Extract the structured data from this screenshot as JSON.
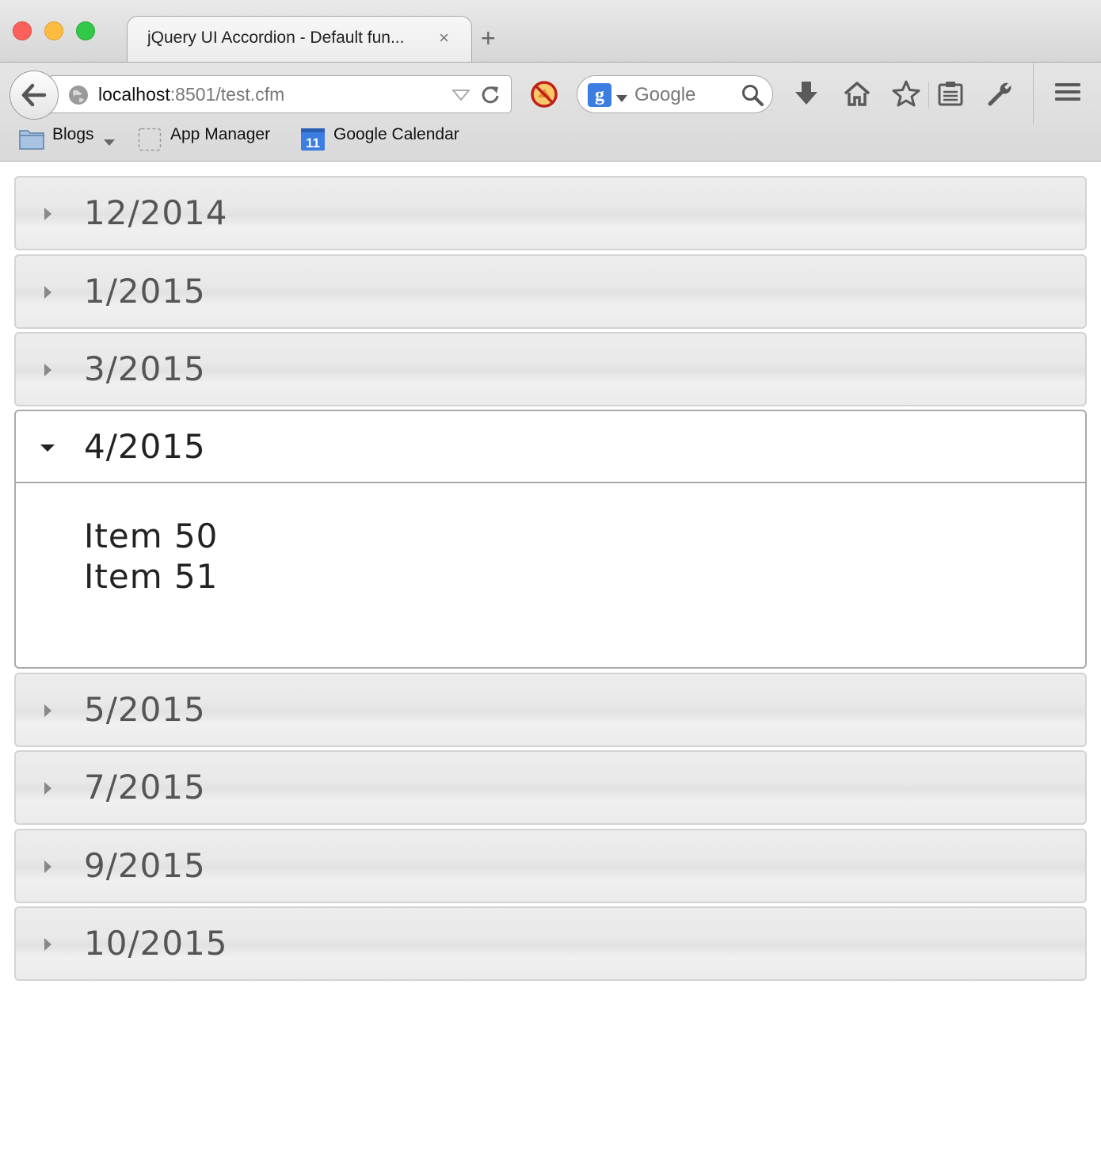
{
  "browser": {
    "tab_title": "jQuery UI Accordion - Default fun...",
    "tab_close": "×",
    "new_tab": "+",
    "url_host": "localhost",
    "url_rest": ":8501/test.cfm",
    "search_engine_badge": "g",
    "search_placeholder": "Google",
    "icons": [
      "back-arrow-icon",
      "globe-icon",
      "dropdown-triangle-icon",
      "reload-icon",
      "blocked-addon-icon",
      "search-icon",
      "download-icon",
      "home-icon",
      "bookmark-star-icon",
      "reading-list-icon",
      "wrench-icon",
      "hamburger-menu-icon"
    ]
  },
  "bookmarks": [
    {
      "label": "Blogs",
      "icon": "folder-icon"
    },
    {
      "label": "App Manager",
      "icon": "app-placeholder-icon"
    },
    {
      "label": "Google Calendar",
      "icon": "calendar-icon",
      "badge": "11"
    }
  ],
  "accordion": {
    "sections": [
      {
        "label": "12/2014",
        "active": false
      },
      {
        "label": "1/2015",
        "active": false
      },
      {
        "label": "3/2015",
        "active": false
      },
      {
        "label": "4/2015",
        "active": true,
        "items": [
          "Item 50",
          "Item 51"
        ]
      },
      {
        "label": "5/2015",
        "active": false
      },
      {
        "label": "7/2015",
        "active": false
      },
      {
        "label": "9/2015",
        "active": false
      },
      {
        "label": "10/2015",
        "active": false
      }
    ]
  },
  "colors": {
    "header_bg": "#e9e9e9",
    "header_border": "#d3d3d3",
    "active_border": "#aaaaaa",
    "header_text": "#555555",
    "active_text": "#222222"
  }
}
